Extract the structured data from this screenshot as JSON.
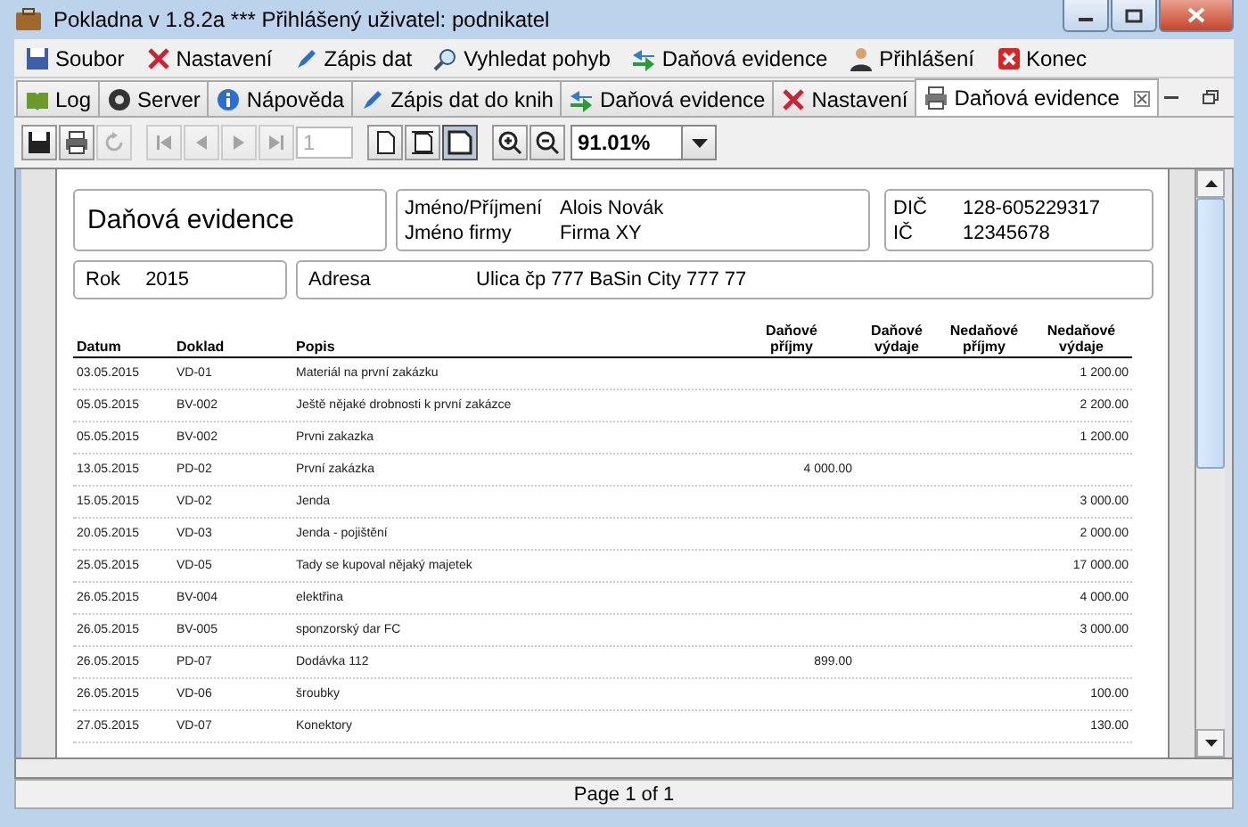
{
  "window": {
    "title": "Pokladna v 1.8.2a ***  Přihlášený uživatel: podnikatel"
  },
  "menu": [
    {
      "label": "Soubor"
    },
    {
      "label": "Nastavení"
    },
    {
      "label": "Zápis dat"
    },
    {
      "label": "Vyhledat pohyb"
    },
    {
      "label": "Daňová evidence"
    },
    {
      "label": "Přihlášení"
    },
    {
      "label": "Konec"
    }
  ],
  "tabs": [
    {
      "label": "Log",
      "selected": false,
      "closable": false
    },
    {
      "label": "Server",
      "selected": false,
      "closable": false
    },
    {
      "label": "Nápověda",
      "selected": false,
      "closable": false
    },
    {
      "label": "Zápis dat do knih",
      "selected": false,
      "closable": false
    },
    {
      "label": "Daňová evidence",
      "selected": false,
      "closable": false
    },
    {
      "label": "Nastavení",
      "selected": false,
      "closable": false
    },
    {
      "label": "Daňová evidence",
      "selected": true,
      "closable": true
    }
  ],
  "toolbar": {
    "file_buttons": [
      {
        "disabled": false
      },
      {
        "disabled": false
      },
      {
        "disabled": true
      }
    ],
    "nav_buttons": [
      {
        "disabled": true
      },
      {
        "disabled": true
      },
      {
        "disabled": true
      },
      {
        "disabled": true
      }
    ],
    "page_field": {
      "value": "1",
      "disabled": true
    },
    "view_buttons": [
      {
        "selected": false
      },
      {
        "selected": false
      },
      {
        "selected": true
      }
    ],
    "zoom": {
      "value": "91.01%"
    }
  },
  "report": {
    "title": "Daňová evidence",
    "name_label": "Jméno/Příjmení",
    "name_value": "Alois  Novák",
    "firm_label": "Jméno firmy",
    "firm_value": "Firma XY",
    "dic_label": "DIČ",
    "dic_value": "128-605229317",
    "ic_label": "IČ",
    "ic_value": "12345678",
    "year_label": "Rok",
    "year_value": "2015",
    "address_label": "Adresa",
    "address_value": "Ulica čp 777  BaSin City 777 77",
    "columns": [
      "Datum",
      "Doklad",
      "Popis",
      "Daňové příjmy",
      "Daňové výdaje",
      "Nedaňové příjmy",
      "Nedaňové výdaje"
    ],
    "rows": [
      {
        "date": "03.05.2015",
        "doc": "VD-01",
        "desc": "Materiál na první zakázku",
        "nedanove_vydaje": "1 200.00"
      },
      {
        "date": "05.05.2015",
        "doc": "BV-002",
        "desc": "Ještě nějaké drobnosti k první zakázce",
        "nedanove_vydaje": "2 200.00"
      },
      {
        "date": "05.05.2015",
        "doc": "BV-002",
        "desc": "Prvni zakazka",
        "nedanove_vydaje": "1 200.00"
      },
      {
        "date": "13.05.2015",
        "doc": "PD-02",
        "desc": "První zakázka",
        "danove_prijmy": "4 000.00"
      },
      {
        "date": "15.05.2015",
        "doc": "VD-02",
        "desc": "Jenda",
        "nedanove_vydaje": "3 000.00"
      },
      {
        "date": "20.05.2015",
        "doc": "VD-03",
        "desc": "Jenda - pojištění",
        "nedanove_vydaje": "2 000.00"
      },
      {
        "date": "25.05.2015",
        "doc": "VD-05",
        "desc": "Tady se kupoval nějaký majetek",
        "nedanove_vydaje": "17 000.00"
      },
      {
        "date": "26.05.2015",
        "doc": "BV-004",
        "desc": "elektřina",
        "nedanove_vydaje": "4 000.00"
      },
      {
        "date": "26.05.2015",
        "doc": "BV-005",
        "desc": "sponzorský dar FC",
        "nedanove_vydaje": "3 000.00"
      },
      {
        "date": "26.05.2015",
        "doc": "PD-07",
        "desc": "Dodávka 112",
        "danove_prijmy": "899.00"
      },
      {
        "date": "26.05.2015",
        "doc": "VD-06",
        "desc": "šroubky",
        "nedanove_vydaje": "100.00"
      },
      {
        "date": "27.05.2015",
        "doc": "VD-07",
        "desc": "Konektory",
        "nedanove_vydaje": "130.00"
      }
    ]
  },
  "status_bar": {
    "text": "Page 1 of 1"
  }
}
